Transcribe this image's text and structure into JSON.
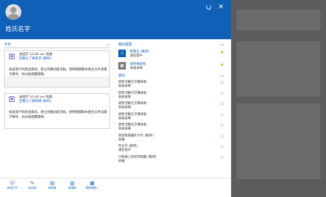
{
  "header": {
    "user_name": "姓氏名字"
  },
  "left": {
    "today_label": "今天",
    "cards": [
      {
        "title": "通話於 10:00 am 到期",
        "subtitle": "回電以了解要求 (範例)",
        "description": "檢查客戶和產品資訊。建立持續追蹤活動。使用相關範本產生信件或電子郵件。指派給相關團隊。"
      },
      {
        "title": "通話於 10:00 am 到期",
        "subtitle": "回電以了解問題 (範例)",
        "description": "檢查客戶和產品資訊。建立持續追蹤活動。使用相關範本產生信件或電子郵件。指派給相關團隊。"
      }
    ]
  },
  "right": {
    "pinned_label": "我的最愛",
    "pinned": [
      {
        "name": "卸建企 (範例)",
        "type": "潛在客戶",
        "color": "#1160b7",
        "icon": "lead-icon"
      },
      {
        "name": "銷售儀表板",
        "type": "系統表單",
        "color": "#7a7a7a",
        "icon": "dashboard-icon"
      }
    ],
    "recent_label": "最近",
    "recent": [
      {
        "name": "銷售活動社交儀表板",
        "type": "系統表單"
      },
      {
        "name": "銷售活動社交儀表板",
        "type": "系統表單"
      },
      {
        "name": "銷售活動社交儀表板",
        "type": "系統表單"
      },
      {
        "name": "銷售活動社交儀表板",
        "type": "系統表單"
      },
      {
        "name": "銷售活動社交儀表板",
        "type": "系統表單"
      },
      {
        "name": "寄回有興趣的卡片 (範例)",
        "type": "商機"
      },
      {
        "name": "馬玉芬 (範例)",
        "type": "潛在客戶"
      },
      {
        "name": "只對線上商店有興趣 (範例)",
        "type": "商機"
      }
    ]
  },
  "toolbar": {
    "buttons": [
      {
        "label": "新增工作",
        "icon": "task-icon"
      },
      {
        "label": "新記錄",
        "icon": "record-icon"
      },
      {
        "label": "新約會",
        "icon": "appointment-icon"
      },
      {
        "label": "新連絡",
        "icon": "contact-icon"
      },
      {
        "label": "更新連絡人",
        "icon": "update-contact-icon"
      }
    ]
  },
  "colors": {
    "accent": "#1160b7",
    "star_filled": "#e8a21a",
    "calendar": "#7a5fb0"
  }
}
